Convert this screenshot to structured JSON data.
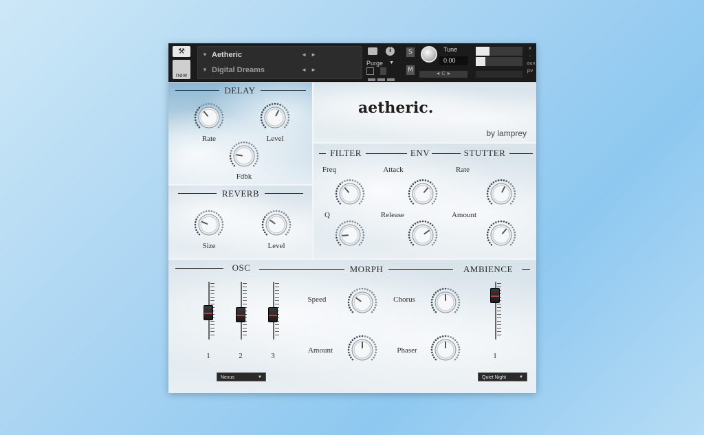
{
  "header": {
    "instrument_name": "Aetheric",
    "snapshot_name": "Digital Dreams",
    "purge_label": "Purge",
    "s_label": "S",
    "m_label": "M",
    "tune_label": "Tune",
    "tune_value": "0.00",
    "pan_label": "◄ C ►",
    "new_label": "new",
    "aux_label": "x\n–\naux\npv",
    "meter_levels": [
      0.3,
      0.2
    ]
  },
  "brand": {
    "title": "aetheric.",
    "subtitle": "by lamprey"
  },
  "delay": {
    "title": "DELAY",
    "knobs": [
      "Rate",
      "Level",
      "Fdbk"
    ]
  },
  "reverb": {
    "title": "REVERB",
    "knobs": [
      "Size",
      "Level"
    ]
  },
  "filter": {
    "title": "FILTER",
    "knobs": [
      "Freq",
      "Q"
    ]
  },
  "env": {
    "title": "ENV",
    "knobs": [
      "Attack",
      "Release"
    ]
  },
  "stutter": {
    "title": "STUTTER",
    "knobs": [
      "Rate",
      "Amount"
    ]
  },
  "osc": {
    "title": "OSC",
    "faders": [
      "1",
      "2",
      "3"
    ],
    "preset": "Nexus",
    "fader_levels": [
      0.45,
      0.4,
      0.4
    ]
  },
  "morph": {
    "title": "MORPH",
    "knobs": [
      "Speed",
      "Amount",
      "Chorus",
      "Phaser"
    ]
  },
  "ambience": {
    "title": "AMBIENCE",
    "faders": [
      "1"
    ],
    "preset": "Quiet Night",
    "fader_levels": [
      0.85
    ]
  },
  "knob_values": {
    "delay_rate": 0.35,
    "delay_level": 0.6,
    "delay_fdbk": 0.2,
    "reverb_size": 0.25,
    "reverb_level": 0.3,
    "filter_freq": 0.35,
    "filter_q": 0.15,
    "env_attack": 0.65,
    "env_release": 0.7,
    "stutter_rate": 0.6,
    "stutter_amount": 0.65,
    "morph_speed": 0.3,
    "morph_amount": 0.5,
    "morph_chorus": 0.5,
    "morph_phaser": 0.5
  }
}
